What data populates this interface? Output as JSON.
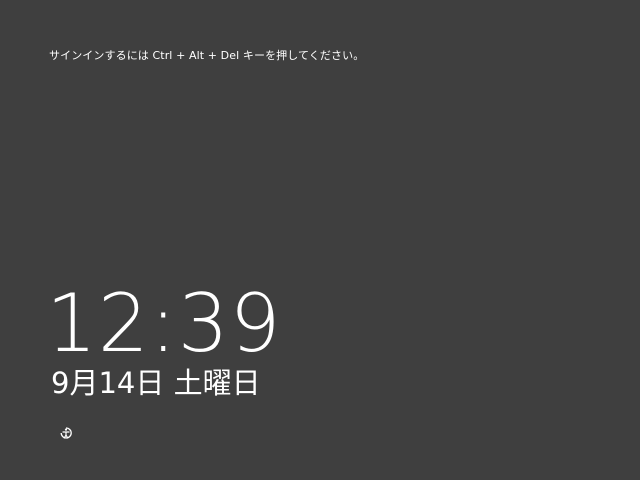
{
  "lock_screen": {
    "signin_prompt": "サインインするには Ctrl + Alt + Del キーを押してください。",
    "time": "12:39",
    "date": "9月14日 土曜日"
  },
  "icons": {
    "ease_of_access": "ease-of-access-icon"
  },
  "colors": {
    "background": "#3f3f3f",
    "text": "#ffffff"
  }
}
